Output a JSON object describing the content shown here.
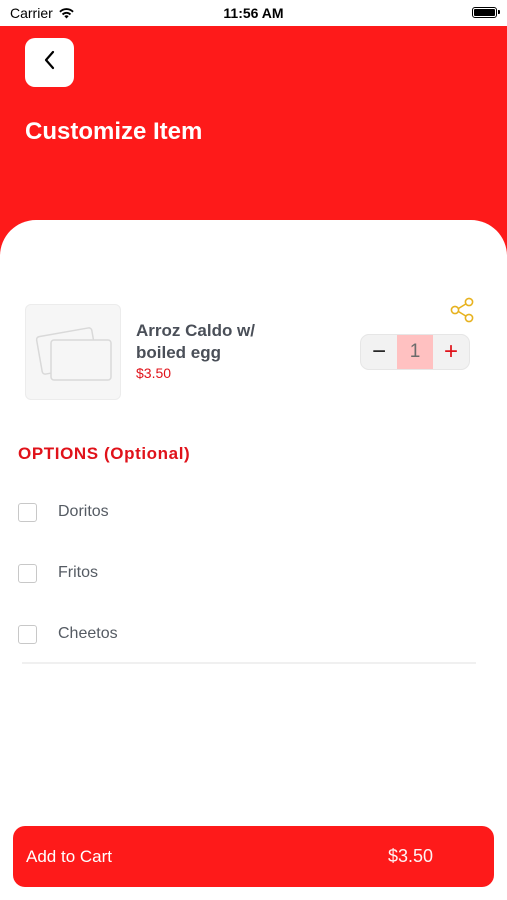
{
  "status_bar": {
    "carrier": "Carrier",
    "time": "11:56 AM"
  },
  "header": {
    "title": "Customize Item",
    "back_icon": "chevron-left-icon",
    "background_color": "#fe1a1a"
  },
  "item": {
    "name": "Arroz Caldo w/ boiled egg",
    "price": "$3.50",
    "image_icon": "image-placeholder-icon",
    "share_icon": "share-icon"
  },
  "quantity": {
    "value": "1",
    "minus_label": "−",
    "plus_label": "+"
  },
  "options": {
    "title": "OPTIONS (Optional)",
    "items": [
      {
        "label": "Doritos",
        "checked": false
      },
      {
        "label": "Fritos",
        "checked": false
      },
      {
        "label": "Cheetos",
        "checked": false
      }
    ]
  },
  "cart": {
    "label": "Add to Cart",
    "price": "$3.50"
  },
  "colors": {
    "accent": "#fe1a1a",
    "accent_text": "#e0121a",
    "share_icon": "#e7b21f"
  }
}
